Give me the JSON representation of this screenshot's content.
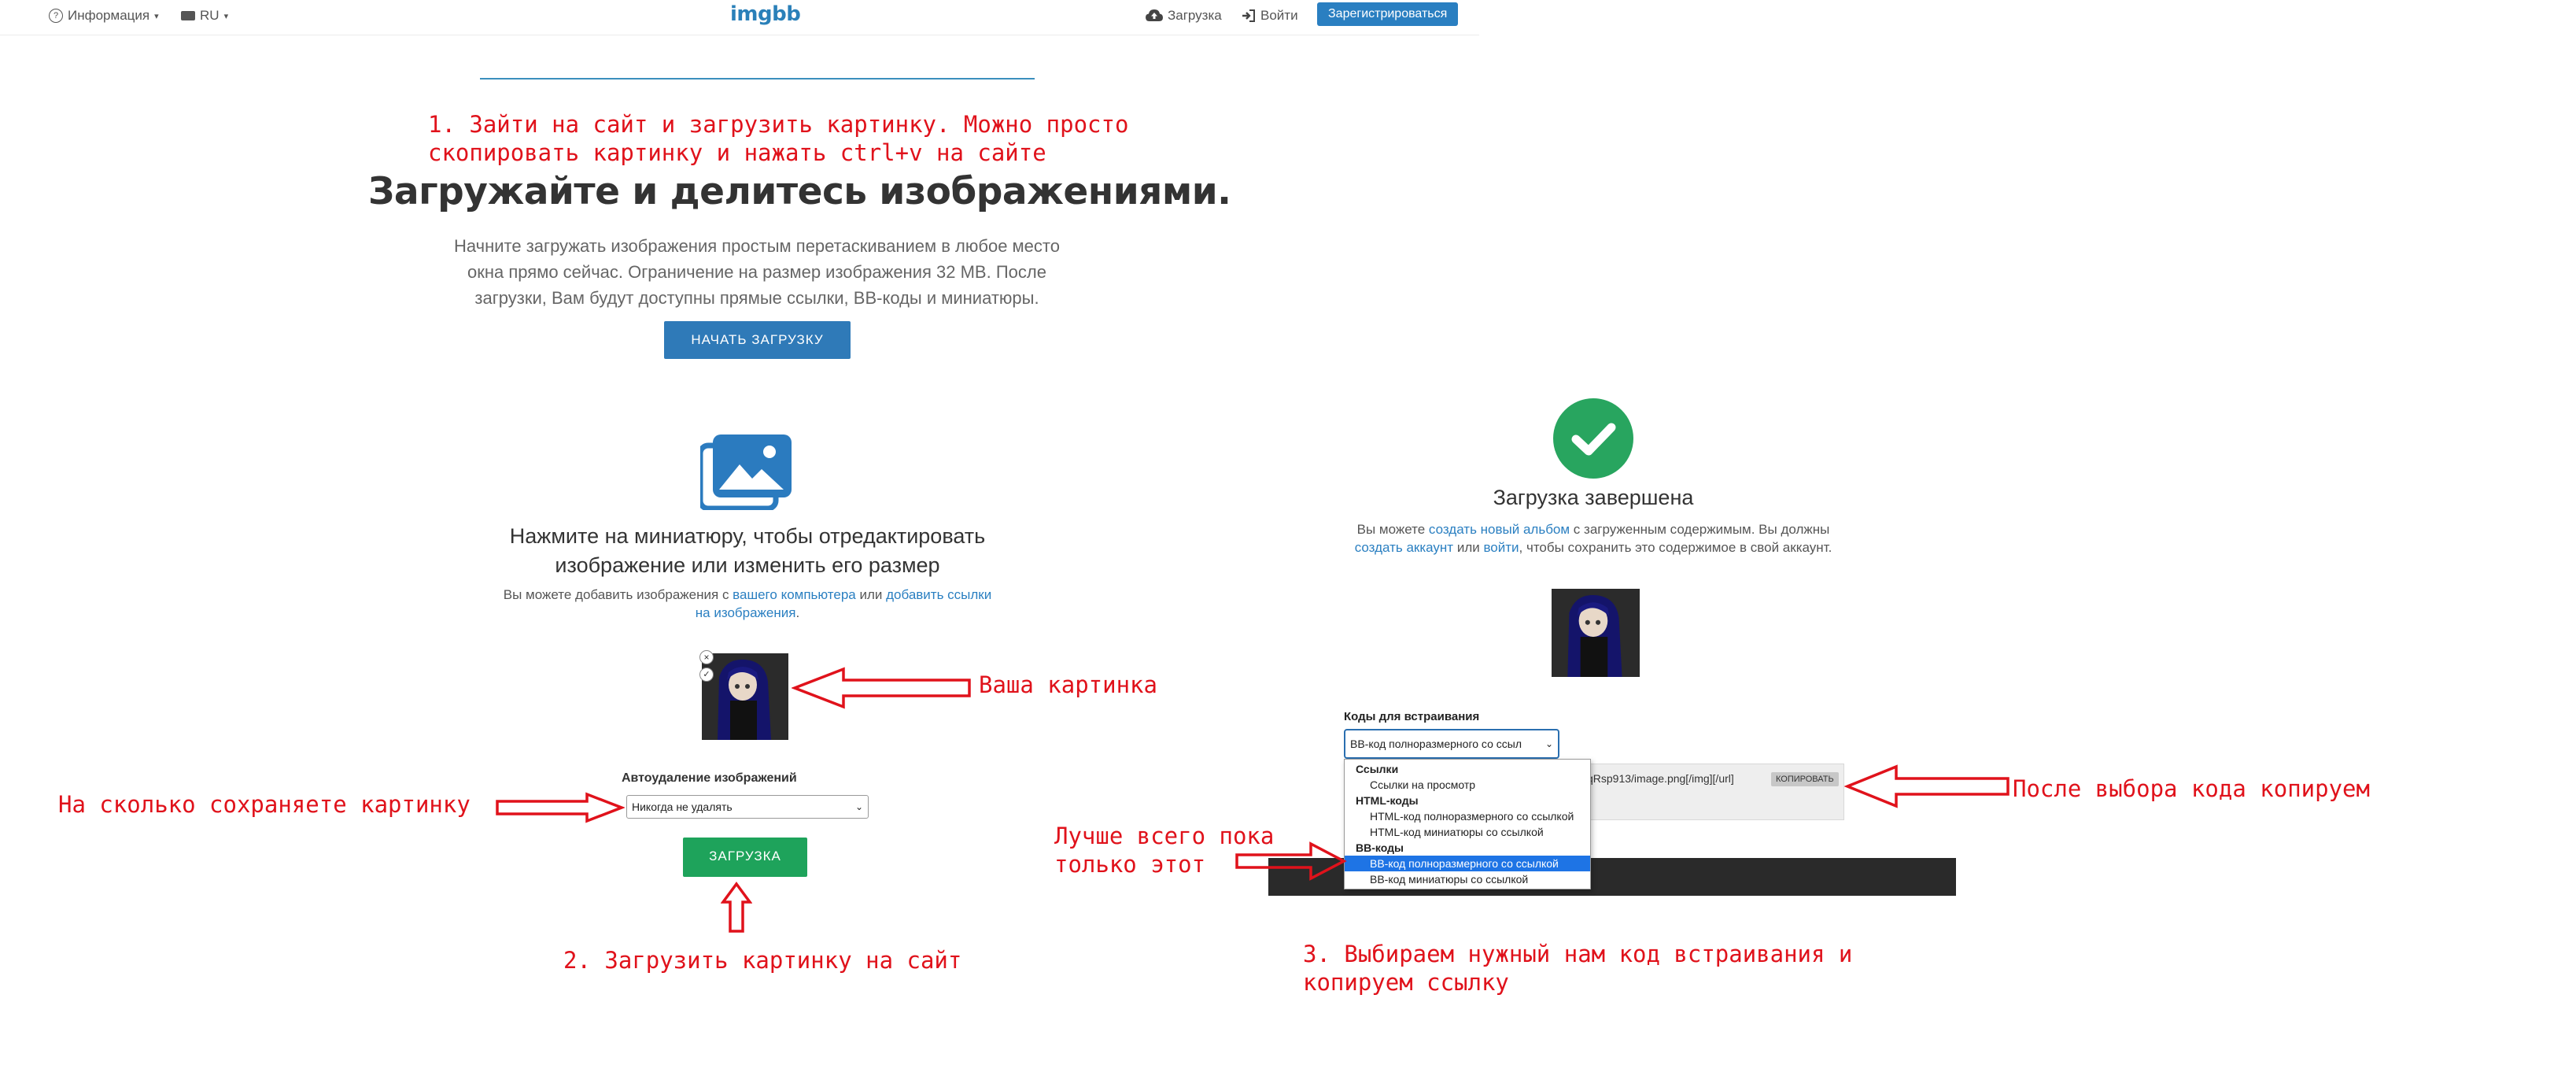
{
  "nav": {
    "info_label": "Информация",
    "lang_label": "RU",
    "logo": "imgbb",
    "upload_label": "Загрузка",
    "login_label": "Войти",
    "register_label": "Зарегистрироваться"
  },
  "hero": {
    "title": "Загружайте и делитесь изображениями.",
    "subtitle_line1": "Начните загружать изображения простым перетаскиванием в любое место",
    "subtitle_line2": "окна прямо сейчас. Ограничение на размер изображения 32 MB. После",
    "subtitle_line3": "загрузки, Вам будут доступны прямые ссылки, BB-коды и миниатюры.",
    "start_button": "НАЧАТЬ ЗАГРУЗКУ"
  },
  "upload_panel": {
    "title_line1": "Нажмите на миниатюру, чтобы отредактировать",
    "title_line2": "изображение или изменить его размер",
    "sub_prefix": "Вы можете добавить изображения с ",
    "sub_link1": "вашего компьютера",
    "sub_mid": " или ",
    "sub_link2a": "добавить ссылки",
    "sub_link2b": "на изображения",
    "sub_end": ".",
    "autodelete_label": "Автоудаление изображений",
    "autodelete_value": "Никогда не удалять",
    "upload_button": "ЗАГРУЗКА"
  },
  "done_panel": {
    "title": "Загрузка завершена",
    "line1_a": "Вы можете ",
    "line1_link": "создать новый альбом",
    "line1_b": " с загруженным содержимым. Вы должны",
    "line2_link1": "создать аккаунт",
    "line2_a": " или ",
    "line2_link2": "войти",
    "line2_b": ", чтобы сохранить это содержимое в свой аккаунт.",
    "embed_label": "Коды для встраивания",
    "embed_selected": "BB-код полноразмерного со ссыл",
    "code_fragment": "qRsp913/image.png[/img][/url]",
    "copy_button": "КОПИРОВАТЬ",
    "dropdown": [
      {
        "type": "group",
        "label": "Ссылки"
      },
      {
        "type": "option",
        "label": "Ссылки на просмотр"
      },
      {
        "type": "group",
        "label": "HTML-коды"
      },
      {
        "type": "option",
        "label": "HTML-код полноразмерного со ссылкой"
      },
      {
        "type": "option",
        "label": "HTML-код миниатюры со ссылкой"
      },
      {
        "type": "group",
        "label": "BB-коды"
      },
      {
        "type": "option",
        "label": "BB-код полноразмерного со ссылкой",
        "selected": true
      },
      {
        "type": "option",
        "label": "BB-код миниатюры со ссылкой"
      }
    ]
  },
  "annotations": {
    "step1": "1. Зайти на сайт и загрузить картинку. Можно просто\nскопировать картинку и нажать ctrl+v на сайте",
    "your_picture": "Ваша картинка",
    "how_long": "На сколько сохраняете картинку",
    "step2": "2. Загрузить картинку на сайт",
    "best_option": "Лучше всего пока\nтолько этот",
    "after_select": "После выбора кода копируем",
    "step3": "3. Выбираем нужный нам код встраивания и\nкопируем ссылку"
  },
  "colors": {
    "accent_blue": "#2a7fc1",
    "upload_green": "#1ea35b",
    "success_green": "#28a55f",
    "annotation_red": "#e0121b",
    "icon_blue": "#2b7bbf"
  }
}
